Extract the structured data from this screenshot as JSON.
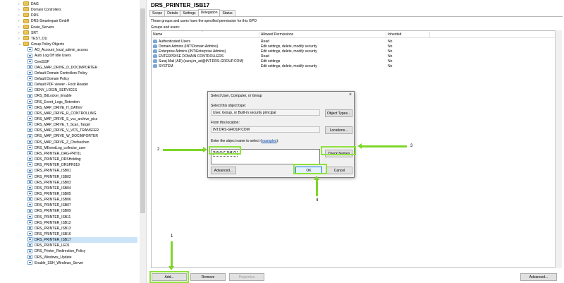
{
  "tree": {
    "items": [
      {
        "label": "DAG",
        "type": "folder",
        "indent": 0,
        "expander": "›"
      },
      {
        "label": "Domain Controllers",
        "type": "folder",
        "indent": 0,
        "expander": "›"
      },
      {
        "label": "DRS",
        "type": "folder",
        "indent": 0,
        "expander": "›"
      },
      {
        "label": "DRS-Smartrepair GmbH",
        "type": "folder",
        "indent": 0,
        "expander": "›"
      },
      {
        "label": "Enaio_Servers",
        "type": "folder",
        "indent": 0,
        "expander": "›"
      },
      {
        "label": "SRT",
        "type": "folder",
        "indent": 0,
        "expander": "›"
      },
      {
        "label": "TEST_OU",
        "type": "folder",
        "indent": 0,
        "expander": "›"
      },
      {
        "label": "Group Policy Objects",
        "type": "folder",
        "indent": 0,
        "expander": "⌄"
      },
      {
        "label": "AO_Account_local_admin_access",
        "type": "gpo",
        "indent": 1
      },
      {
        "label": "Auto Log Off Idle Users",
        "type": "gpo",
        "indent": 1
      },
      {
        "label": "CredSSP",
        "type": "gpo",
        "indent": 1
      },
      {
        "label": "DAG_MAP_DRIVE_D_DOCIMPORTER",
        "type": "gpo",
        "indent": 1
      },
      {
        "label": "Default Domain Controllers Policy",
        "type": "gpo",
        "indent": 1
      },
      {
        "label": "Default Domain Policy",
        "type": "gpo",
        "indent": 1
      },
      {
        "label": "Default PDF viewer - Foxit Reader",
        "type": "gpo",
        "indent": 1
      },
      {
        "label": "DENY_LOGIN_SERVICES",
        "type": "gpo",
        "indent": 1
      },
      {
        "label": "DRS_BitLocker_Enable",
        "type": "gpo",
        "indent": 1
      },
      {
        "label": "DRS_Event_Logs_Retention",
        "type": "gpo",
        "indent": 1
      },
      {
        "label": "DRS_MAP_DRIVE_H_DATEV",
        "type": "gpo",
        "indent": 1
      },
      {
        "label": "DRS_MAP_DRIVE_R_CONTROLLING",
        "type": "gpo",
        "indent": 1
      },
      {
        "label": "DRS_MAP_DRIVE_S_vcs_archive_pics",
        "type": "gpo",
        "indent": 1
      },
      {
        "label": "DRS_MAP_DRIVE_T_Scan_Target",
        "type": "gpo",
        "indent": 1
      },
      {
        "label": "DRS_MAP_DRIVE_V_VCS_TRANSFER",
        "type": "gpo",
        "indent": 1
      },
      {
        "label": "DRS_MAP_DRIVE_W_DOCIMPORTER",
        "type": "gpo",
        "indent": 1
      },
      {
        "label": "DRS_MAP_DRIVE_Z_Chefsachen",
        "type": "gpo",
        "indent": 1
      },
      {
        "label": "DRS_MEventLog_collector_user",
        "type": "gpo",
        "indent": 1
      },
      {
        "label": "DRS_PRINTER_DAG-PRT01",
        "type": "gpo",
        "indent": 1
      },
      {
        "label": "DRS_PRINTER_DRSHolding",
        "type": "gpo",
        "indent": 1
      },
      {
        "label": "DRS_PRINTER_DRSPR019",
        "type": "gpo",
        "indent": 1
      },
      {
        "label": "DRS_PRINTER_ISB01",
        "type": "gpo",
        "indent": 1
      },
      {
        "label": "DRS_PRINTER_ISB02",
        "type": "gpo",
        "indent": 1
      },
      {
        "label": "DRS_PRINTER_ISB03",
        "type": "gpo",
        "indent": 1
      },
      {
        "label": "DRS_PRINTER_ISB04",
        "type": "gpo",
        "indent": 1
      },
      {
        "label": "DRS_PRINTER_ISB05",
        "type": "gpo",
        "indent": 1
      },
      {
        "label": "DRS_PRINTER_ISB06",
        "type": "gpo",
        "indent": 1
      },
      {
        "label": "DRS_PRINTER_ISB07",
        "type": "gpo",
        "indent": 1
      },
      {
        "label": "DRS_PRINTER_ISB09",
        "type": "gpo",
        "indent": 1
      },
      {
        "label": "DRS_PRINTER_ISB11",
        "type": "gpo",
        "indent": 1
      },
      {
        "label": "DRS_PRINTER_ISB12",
        "type": "gpo",
        "indent": 1
      },
      {
        "label": "DRS_PRINTER_ISB13",
        "type": "gpo",
        "indent": 1
      },
      {
        "label": "DRS_PRINTER_ISB16",
        "type": "gpo",
        "indent": 1
      },
      {
        "label": "DRS_PRINTER_ISB17",
        "type": "gpo",
        "indent": 1,
        "selected": true
      },
      {
        "label": "DRS_PRINTER_LE01",
        "type": "gpo",
        "indent": 1
      },
      {
        "label": "DRS_Printer_Redirection_Policy",
        "type": "gpo",
        "indent": 1
      },
      {
        "label": "DRS_Windows_Update",
        "type": "gpo",
        "indent": 1
      },
      {
        "label": "Enable_SSH_Windows_Server",
        "type": "gpo",
        "indent": 1
      }
    ]
  },
  "gpo": {
    "title": "DRS_PRINTER_ISB17",
    "tabs": [
      "Scope",
      "Details",
      "Settings",
      "Delegation",
      "Status"
    ],
    "active_tab": "Delegation",
    "description": "These groups and users have the specified permission for this GPO",
    "groups_label": "Groups and users:",
    "columns": [
      "Name",
      "Allowed Permissions",
      "Inherited"
    ],
    "rows": [
      {
        "name": "Authenticated Users",
        "perm": "Read",
        "inherited": "No"
      },
      {
        "name": "Domain Admins (INT\\Domain Admins)",
        "perm": "Edit settings, delete, modify security",
        "inherited": "No"
      },
      {
        "name": "Enterprise Admins (INT\\Enterprise Admins)",
        "perm": "Edit settings, delete, modify security",
        "inherited": "No"
      },
      {
        "name": "ENTERPRISE DOMAIN CONTROLLERS",
        "perm": "Read",
        "inherited": "No"
      },
      {
        "name": "Suraj Mali (AD) (suraj.m_ad@INT.DRS-GROUP.COM)",
        "perm": "Edit settings",
        "inherited": "No"
      },
      {
        "name": "SYSTEM",
        "perm": "Edit settings, delete, modify security",
        "inherited": "No"
      }
    ],
    "buttons": {
      "add": "Add...",
      "remove": "Remove",
      "properties": "Properties",
      "advanced": "Advanced..."
    }
  },
  "dialog": {
    "title": "Select User, Computer, or Group",
    "close": "×",
    "object_type_label": "Select this object type:",
    "object_type_value": "User, Group, or Built-in security principal",
    "object_types_button": "Object Types...",
    "location_label": "From this location:",
    "location_value": "INT.DRS-GROUP.COM",
    "locations_button": "Locations...",
    "name_label": "Enter the object name to select",
    "examples_link": "examples",
    "name_value": "Printer_ISB17",
    "check_names_button": "Check Names",
    "advanced_button": "Advanced...",
    "ok_button": "OK",
    "cancel_button": "Cancel"
  },
  "annotations": {
    "n1": "1",
    "n2": "2",
    "n3": "3",
    "n4": "4",
    "color": "#8ee23c"
  }
}
